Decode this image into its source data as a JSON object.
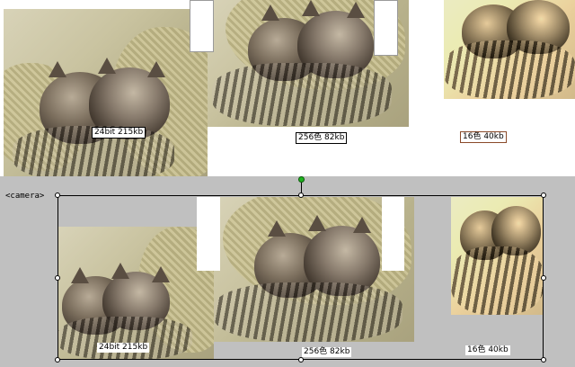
{
  "top_row": {
    "caption_24bit": "24bit 215kb",
    "caption_256": "256色 82kb",
    "caption_16": "16色 40kb"
  },
  "camera": {
    "label": "<camera>",
    "caption_24bit": "24bit 215kb",
    "caption_256": "256色 82kb",
    "caption_16": "16色 40kb"
  }
}
